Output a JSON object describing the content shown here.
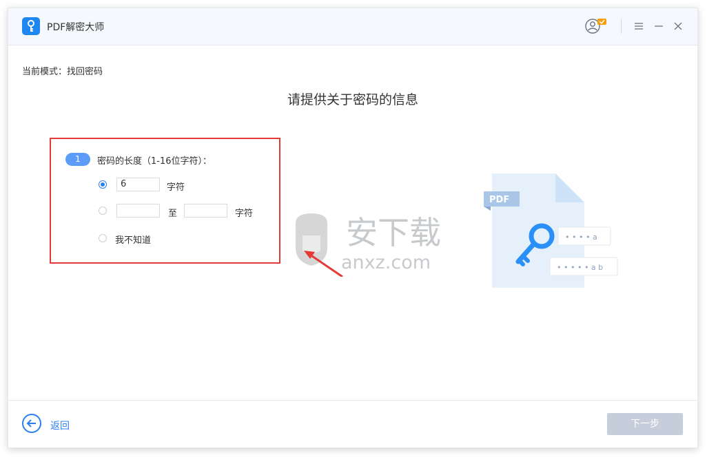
{
  "app": {
    "title": "PDF解密大师"
  },
  "mode": {
    "label": "当前模式：找回密码"
  },
  "heading": "请提供关于密码的信息",
  "step": {
    "number": "1",
    "label": "密码的长度（1-16位字符）：",
    "options": {
      "fixed": {
        "value": "6",
        "suffix": "字符",
        "checked": true
      },
      "range": {
        "from": "",
        "separator": "至",
        "to": "",
        "suffix": "字符",
        "checked": false
      },
      "unknown": {
        "label": "我不知道",
        "checked": false
      }
    }
  },
  "illustration": {
    "badge": "PDF",
    "masked_1": "• • • • a",
    "masked_2": "• • • • • a b"
  },
  "watermark": {
    "main": "安下载",
    "sub": "anxz.com"
  },
  "footer": {
    "back_label": "返回",
    "next_label": "下一步"
  },
  "colors": {
    "accent": "#2a7ff0",
    "highlight_border": "#e53935",
    "disabled_button": "#c6cddb"
  }
}
